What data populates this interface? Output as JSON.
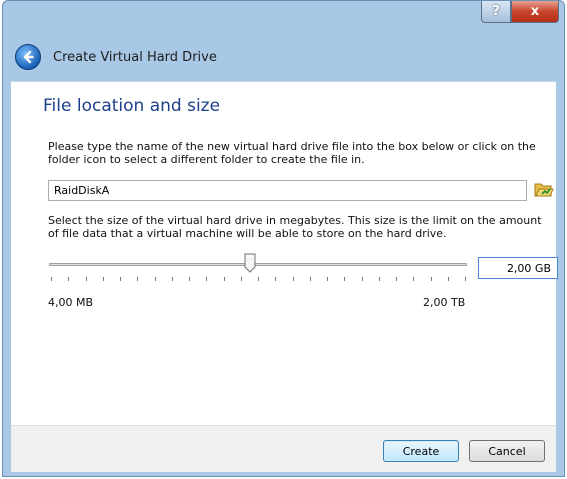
{
  "window": {
    "help_label": "?",
    "close_label": "x",
    "title": "Create Virtual Hard Drive"
  },
  "page": {
    "section_title": "File location and size",
    "location_description": "Please type the name of the new virtual hard drive file into the box below or click on the folder icon to select a different folder to create the file in.",
    "file_name": "RaidDiskA",
    "size_description": "Select the size of the virtual hard drive in megabytes. This size is the limit on the amount of file data that a virtual machine will be able to store on the hard drive.",
    "slider": {
      "min_label": "4,00 MB",
      "max_label": "2,00 TB",
      "position_fraction": 0.48,
      "tick_count": 25
    },
    "size_value": "2,00 GB"
  },
  "footer": {
    "create_label": "Create",
    "cancel_label": "Cancel"
  },
  "icons": {
    "back": "back-arrow-icon",
    "folder": "folder-open-icon"
  },
  "colors": {
    "title_accent": "#1d3f8a",
    "frame": "#a9c8e6",
    "close_button": "#c8442c"
  }
}
